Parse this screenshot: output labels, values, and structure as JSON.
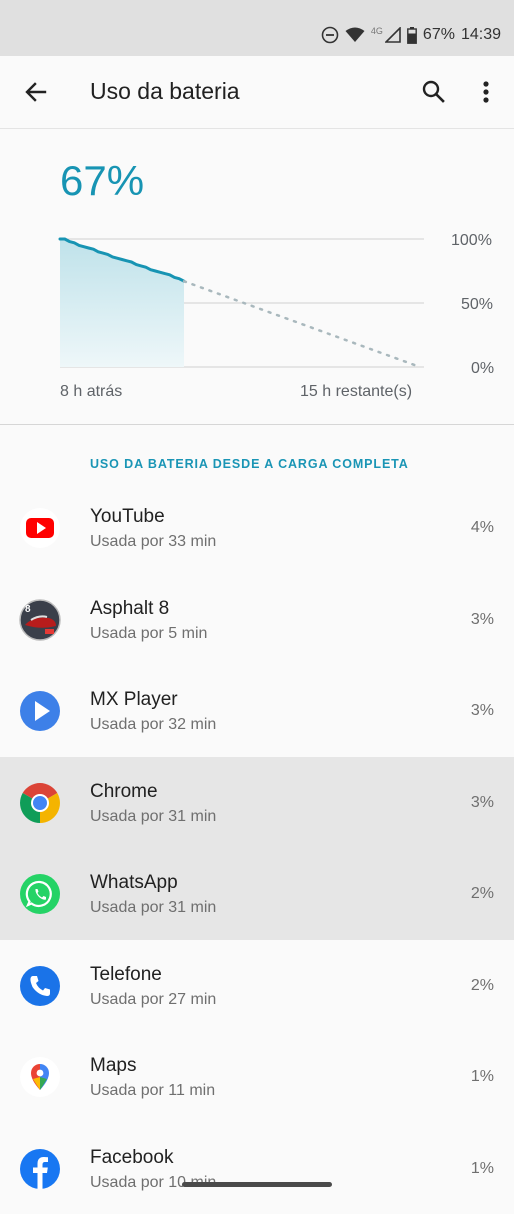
{
  "status_bar": {
    "battery": "67%",
    "time": "14:39",
    "network": "4G",
    "icons": [
      "dnd-icon",
      "wifi-icon",
      "signal-icon",
      "battery-icon"
    ]
  },
  "app_bar": {
    "title": "Uso da bateria",
    "back_icon": "arrow-left-icon",
    "search_icon": "search-icon",
    "more_icon": "more-vert-icon"
  },
  "battery": {
    "level": "67%",
    "y_labels": [
      "100%",
      "50%",
      "0%"
    ],
    "x_start": "8 h atrás",
    "x_end": "15 h restante(s)",
    "accent": "#1794b3"
  },
  "chart_data": {
    "type": "line",
    "y_unit": "%",
    "ylim": [
      0,
      100
    ],
    "series": [
      {
        "values": [
          100,
          100,
          98,
          97,
          95,
          94,
          93,
          92,
          90,
          89,
          88,
          86,
          85,
          84,
          83,
          82,
          80,
          79,
          78,
          76,
          75,
          74,
          73,
          72,
          70,
          69,
          67
        ]
      }
    ],
    "projection": {
      "from": 67,
      "to": 0,
      "style": "dotted"
    },
    "yticks": [
      "100%",
      "50%",
      "0%"
    ],
    "xticks": [
      "8 h atrás",
      "15 h restante(s)"
    ]
  },
  "section_header": "USO DA BATERIA DESDE A CARGA COMPLETA",
  "apps": [
    {
      "name": "YouTube",
      "usage": "Usada por 33 min",
      "percent": "4%",
      "icon": "youtube-icon",
      "selected": false
    },
    {
      "name": "Asphalt 8",
      "usage": "Usada por 5 min",
      "percent": "3%",
      "icon": "asphalt-icon",
      "selected": false
    },
    {
      "name": "MX Player",
      "usage": "Usada por 32 min",
      "percent": "3%",
      "icon": "mx-player-icon",
      "selected": false
    },
    {
      "name": "Chrome",
      "usage": "Usada por 31 min",
      "percent": "3%",
      "icon": "chrome-icon",
      "selected": true
    },
    {
      "name": "WhatsApp",
      "usage": "Usada por 31 min",
      "percent": "2%",
      "icon": "whatsapp-icon",
      "selected": true
    },
    {
      "name": "Telefone",
      "usage": "Usada por 27 min",
      "percent": "2%",
      "icon": "phone-icon",
      "selected": false
    },
    {
      "name": "Maps",
      "usage": "Usada por 11 min",
      "percent": "1%",
      "icon": "maps-icon",
      "selected": false
    },
    {
      "name": "Facebook",
      "usage": "Usada por 10 min",
      "percent": "1%",
      "icon": "facebook-icon",
      "selected": false
    }
  ]
}
